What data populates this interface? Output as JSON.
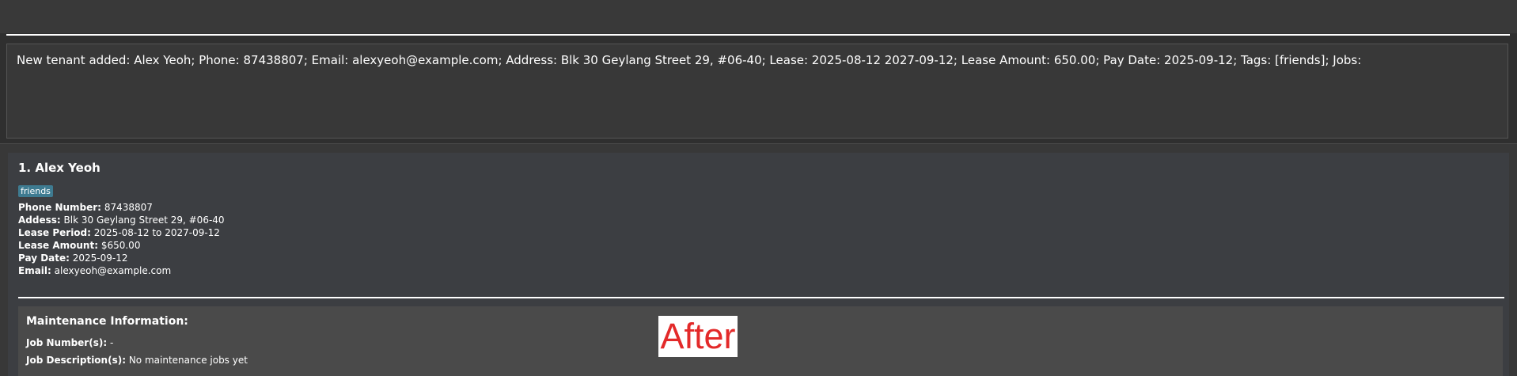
{
  "result_display": {
    "text": "New tenant added: Alex Yeoh; Phone: 87438807; Email: alexyeoh@example.com; Address: Blk 30 Geylang Street 29, #06-40; Lease: 2025-08-12 2027-09-12; Lease Amount: 650.00; Pay Date: 2025-09-12; Tags: [friends]; Jobs:"
  },
  "tenant": {
    "name": "1. Alex Yeoh",
    "tag": "friends",
    "phone_label": "Phone Number:",
    "phone": "87438807",
    "address_label": "Addess:",
    "address": "Blk 30 Geylang Street 29, #06-40",
    "lease_period_label": "Lease Period:",
    "lease_period": "2025-08-12 to 2027-09-12",
    "lease_amount_label": "Lease Amount:",
    "lease_amount": "$650.00",
    "pay_date_label": "Pay Date:",
    "pay_date": "2025-09-12",
    "email_label": "Email:",
    "email": "alexyeoh@example.com"
  },
  "maintenance": {
    "title": "Maintenance Information:",
    "job_number_label": "Job Number(s):",
    "job_number": "-",
    "job_description_label": "Job Description(s):",
    "job_description": "No maintenance jobs yet"
  },
  "overlay": {
    "after_label": "After",
    "after_color": "#e32a2a"
  }
}
